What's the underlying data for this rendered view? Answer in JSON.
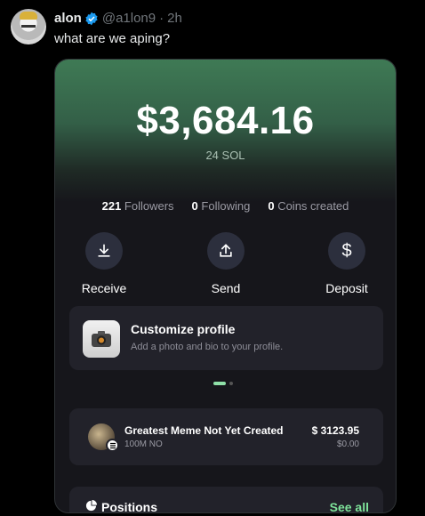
{
  "tweet": {
    "name": "alon",
    "handle": "@a1lon9",
    "separator": "·",
    "time": "2h",
    "text": "what are we aping?"
  },
  "wallet": {
    "balance": "$3,684.16",
    "sol": "24 SOL",
    "stats": {
      "followers_count": "221",
      "followers_label": "Followers",
      "following_count": "0",
      "following_label": "Following",
      "coins_count": "0",
      "coins_label": "Coins created"
    },
    "actions": {
      "receive": "Receive",
      "send": "Send",
      "deposit": "Deposit"
    },
    "customize": {
      "title": "Customize profile",
      "subtitle": "Add a photo and bio to your profile."
    },
    "coin": {
      "name": "Greatest Meme Not Yet Created",
      "quantity": "100M NO",
      "value": "$ 3123.95",
      "usd": "$0.00"
    },
    "positions": {
      "title": "Positions",
      "see_all": "See all"
    }
  },
  "colors": {
    "accent_green": "#7ee39a",
    "verified_blue": "#1d9bf0",
    "hero_green": "#3f7a55"
  },
  "icons": {
    "verified": "verified-badge-icon",
    "receive": "download-icon",
    "send": "upload-icon",
    "deposit": "dollar-icon",
    "customize": "camera-icon",
    "positions": "pie-icon"
  }
}
